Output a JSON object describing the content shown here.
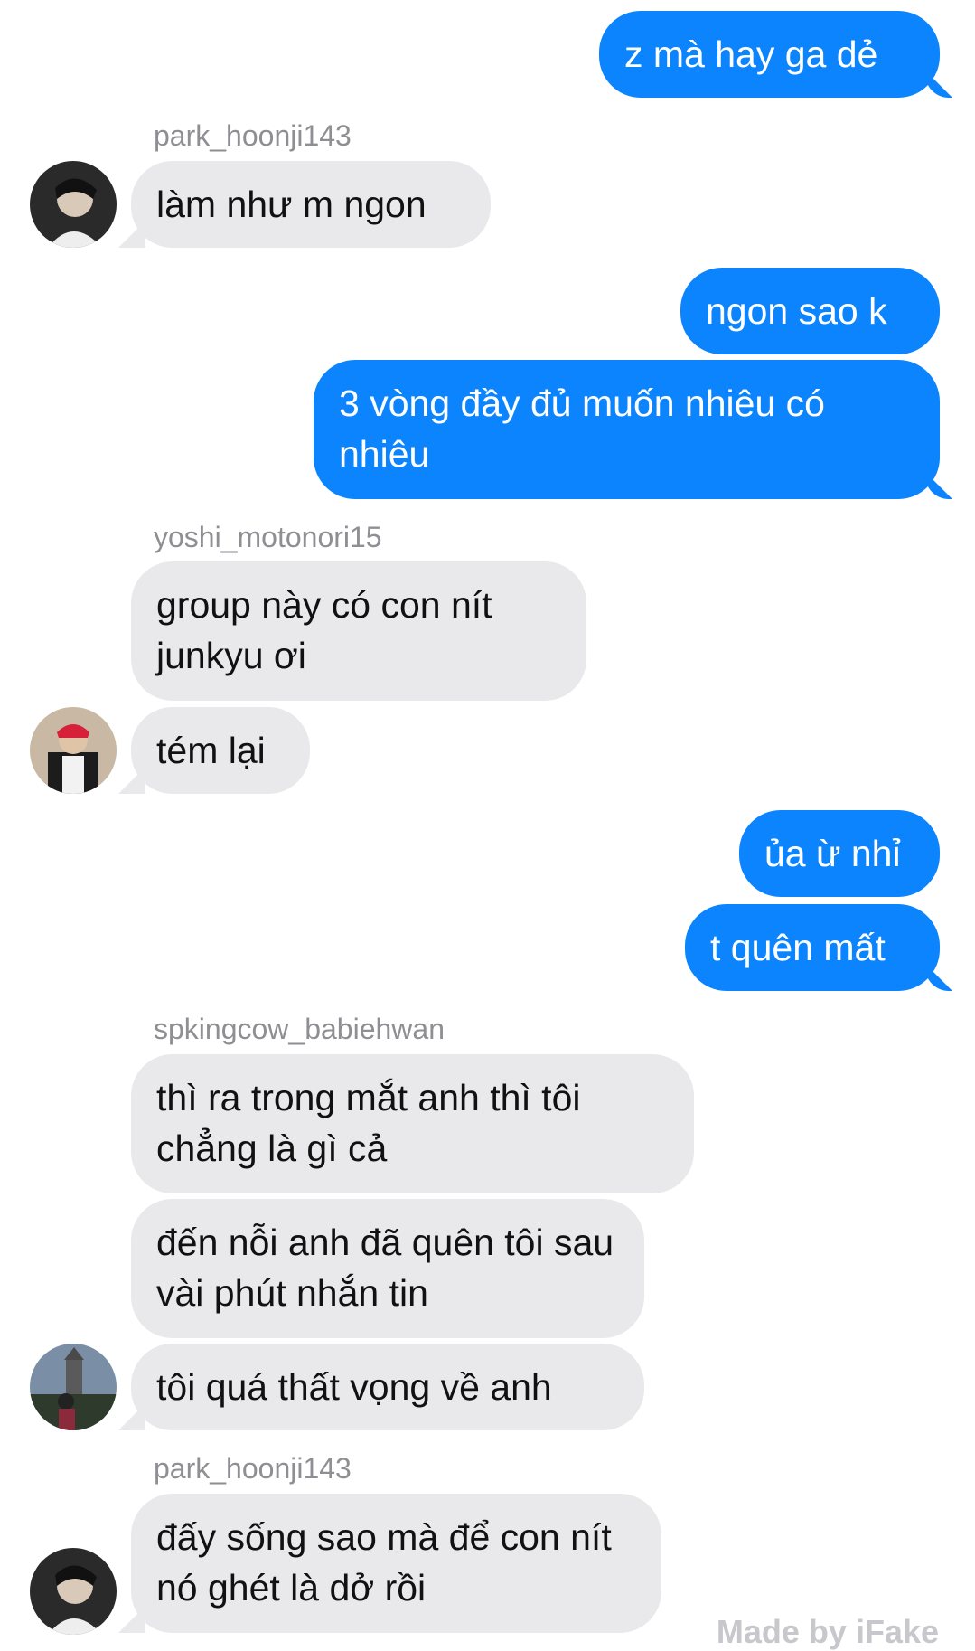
{
  "messages": [
    {
      "text": "z mà hay ga dẻ"
    },
    {
      "sender": "park_hoonji143",
      "text": "làm như m ngon"
    },
    {
      "text": "ngon sao k"
    },
    {
      "text": "3 vòng đầy đủ muốn nhiêu có nhiêu"
    },
    {
      "sender": "yoshi_motonori15",
      "text": "group này có con nít junkyu ơi"
    },
    {
      "text": "tém lại"
    },
    {
      "text": "ủa ừ nhỉ"
    },
    {
      "text": "t quên mất"
    },
    {
      "sender": "spkingcow_babiehwan",
      "text": "thì ra trong mắt anh thì tôi chẳng là gì cả"
    },
    {
      "text": "đến nỗi anh đã quên tôi sau vài phút nhắn tin"
    },
    {
      "text": "tôi quá thất vọng về anh"
    },
    {
      "sender": "park_hoonji143",
      "text": "đấy sống sao mà để con nít nó ghét là dở rồi"
    }
  ],
  "watermark": "Made by iFake",
  "colors": {
    "outgoing": "#0b84fe",
    "incoming": "#e9e9eb",
    "sender_label": "#8e8e93"
  }
}
